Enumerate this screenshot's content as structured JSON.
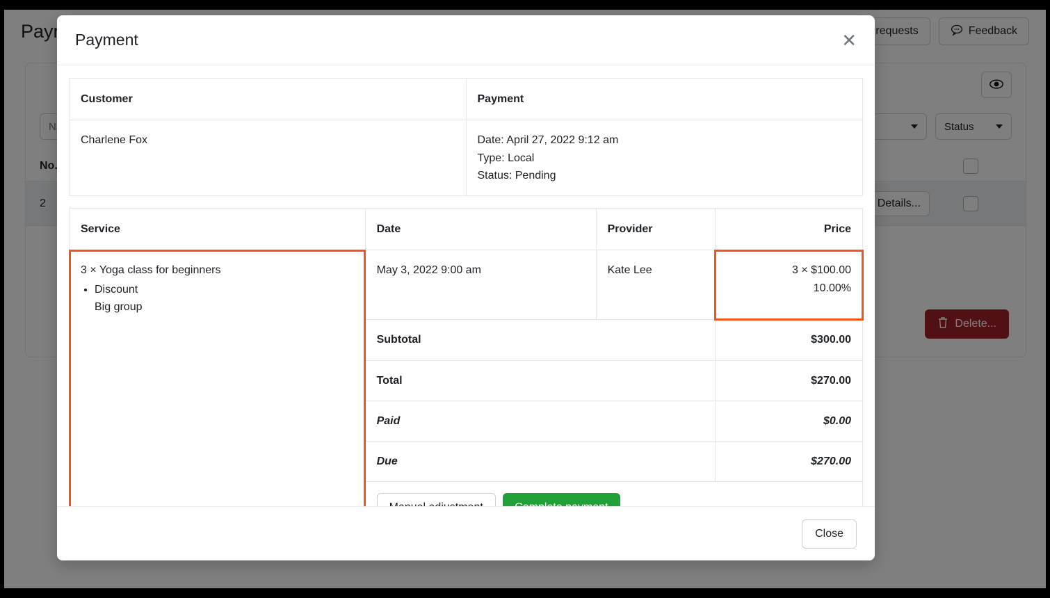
{
  "background": {
    "page_title": "Payments",
    "header_buttons": [
      {
        "label": "",
        "icon": ""
      },
      {
        "label": "",
        "icon": ""
      },
      {
        "label": "requests",
        "icon": ""
      },
      {
        "label": "Feedback",
        "icon": "comment-icon"
      }
    ],
    "toolbar": {
      "eye_icon": "eye-icon"
    },
    "filters": {
      "name_placeholder": "Name",
      "select_value": "",
      "status_label": "Status"
    },
    "table": {
      "columns": [
        "No."
      ],
      "rows": [
        {
          "no": "2",
          "details_label": "Details...",
          "details_icon": "table-icon"
        }
      ]
    },
    "delete_button": {
      "label": "Delete...",
      "icon": "trash-icon"
    }
  },
  "modal": {
    "title": "Payment",
    "close_icon": "close-icon",
    "footer": {
      "close_label": "Close"
    },
    "info": {
      "headers": [
        "Customer",
        "Payment"
      ],
      "customer": "Charlene Fox",
      "payment_lines": [
        "Date: April 27, 2022 9:12 am",
        "Type: Local",
        "Status: Pending"
      ]
    },
    "services": {
      "headers": [
        "Service",
        "Date",
        "Provider",
        "Price"
      ],
      "row": {
        "service": "3 × Yoga class for beginners",
        "discount_label": "Discount",
        "discount_name": "Big group",
        "date": "May 3, 2022 9:00 am",
        "provider": "Kate Lee",
        "price": "3 × $100.00",
        "price_discount": "10.00%"
      },
      "totals": [
        {
          "label": "Subtotal",
          "value": "$300.00",
          "italic": false
        },
        {
          "label": "Total",
          "value": "$270.00",
          "italic": false
        },
        {
          "label": "Paid",
          "value": "$0.00",
          "italic": true
        },
        {
          "label": "Due",
          "value": "$270.00",
          "italic": true
        }
      ],
      "actions": {
        "manual_label": "Manual adjustment",
        "complete_label": "Complete payment"
      }
    }
  },
  "colors": {
    "highlight": "#f4541a",
    "success": "#22a038",
    "danger": "#a02128"
  }
}
